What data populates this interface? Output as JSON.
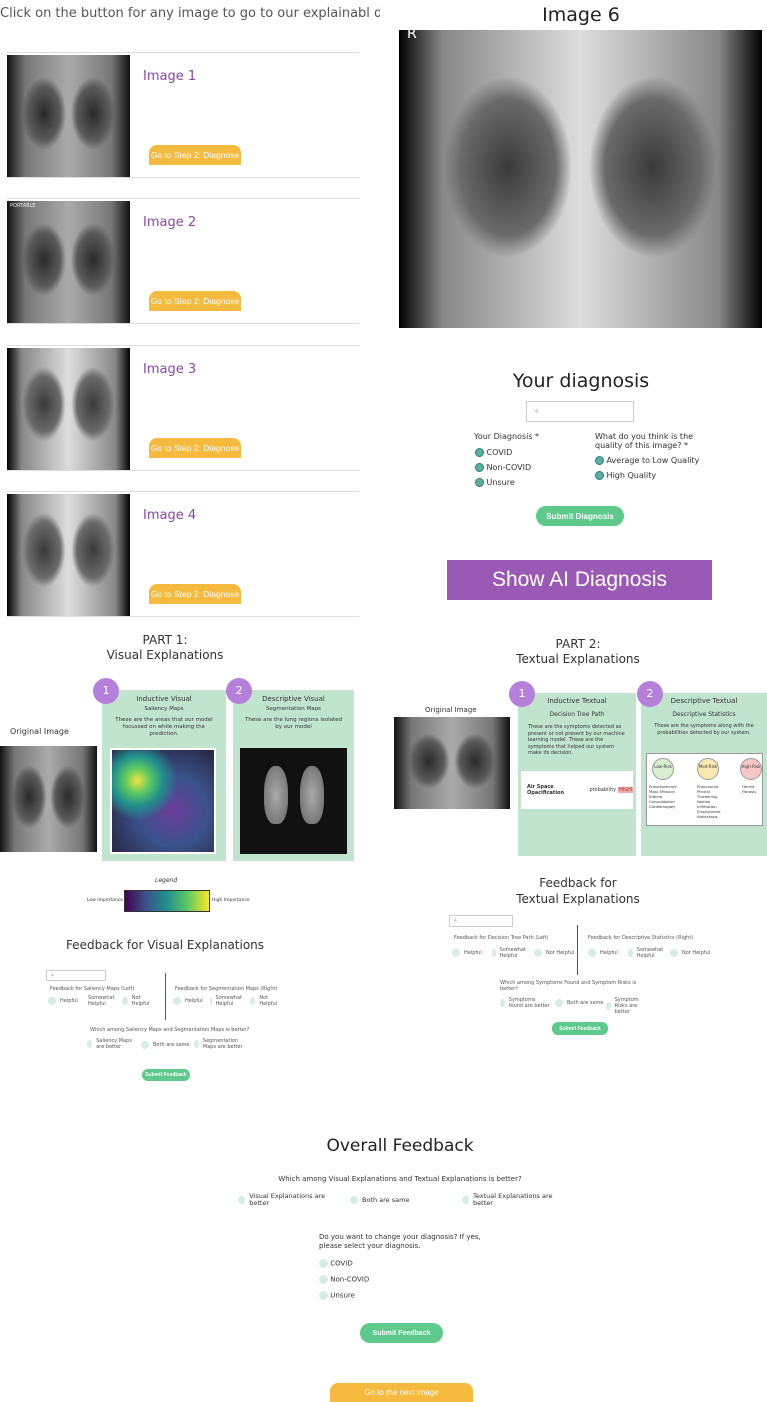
{
  "intro": "Click on the button for any image to go to our explainabl diagnoses",
  "images": [
    {
      "title": "Image 1",
      "button": "Go to Step 2: Diagnose"
    },
    {
      "title": "Image 2",
      "button": "Go to Step 2: Diagnose",
      "overlay": "PORTABLE"
    },
    {
      "title": "Image 3",
      "button": "Go to Step 2: Diagnose"
    },
    {
      "title": "Image 4",
      "button": "Go to Step 2: Diagnose"
    }
  ],
  "image6": {
    "title": "Image 6",
    "marker": "R"
  },
  "diagnosis": {
    "title": "Your diagnosis",
    "input_value": "4",
    "label": "Your Diagnosis *",
    "options": [
      "COVID",
      "Non-COVID",
      "Unsure"
    ],
    "quality_label": "What do you think is the quality of this image? *",
    "quality_options": [
      "Average to Low Quality",
      "High Quality"
    ],
    "submit": "Submit Diagnosis"
  },
  "show_ai": "Show AI Diagnosis",
  "part1": {
    "title": "PART 1:",
    "subtitle": "Visual Explanations",
    "original_label": "Original Image",
    "panel1": {
      "num": "1",
      "title": "Inductive Visual",
      "sub": "Saliency Maps",
      "desc": "These are the areas that our model focussed on while making the prediction."
    },
    "panel2": {
      "num": "2",
      "title": "Descriptive Visual",
      "sub": "Segmentation Maps",
      "desc": "These are the lung regions isolated by our model"
    },
    "legend": {
      "title": "Legend",
      "low": "Low Importance",
      "high": "High Importance"
    },
    "colors": {
      "panel": "#c1e4cf",
      "badge": "#b580d9"
    }
  },
  "part2": {
    "title": "PART 2:",
    "subtitle": "Textual Explanations",
    "original_label": "Original Image",
    "panel1": {
      "num": "1",
      "title": "Inductive Textual",
      "sub": "Decision Tree Path",
      "desc": "These are the symptoms detected as present or not present by our machine learning model. These are the symptoms that helped our system make its decision.",
      "finding": "Air Space Opacification",
      "prob_label": "probability",
      "prob_value": "HIGH"
    },
    "panel2": {
      "num": "2",
      "title": "Descriptive Textual",
      "sub": "Descriptive Statistics",
      "desc": "These are the symptoms along with the probabilities detected by our system.",
      "risks": [
        {
          "label": "Low-Risk",
          "items": "Pneumothorax Mass Effusion Edema Consolidation Cardiomegaly",
          "color": "#d8efd0"
        },
        {
          "label": "Med-Risk",
          "items": "Pneumonia Pleural Thickening Nodule Infiltration Emphysema Atelectasis",
          "color": "#fbe8b0"
        },
        {
          "label": "High-Risk",
          "items": "Hernia Fibrosis",
          "color": "#f7c6c6"
        }
      ]
    }
  },
  "feedback_visual": {
    "title": "Feedback for Visual Explanations",
    "input_value": "4",
    "left_label": "Feedback for Saliency Maps (Left)",
    "right_label": "Feedback for Segmentation Maps (Right)",
    "scale": [
      "Helpful",
      "Somewhat Helpful",
      "Not Helpful"
    ],
    "compare_q": "Which among Saliency Maps and Segmentation Maps is better?",
    "compare_opts": [
      "Saliency Maps are better",
      "Both are same",
      "Segmentation Maps are better"
    ],
    "submit": "Submit Feedback"
  },
  "feedback_textual": {
    "title": "Feedback for",
    "title2": "Textual Explanations",
    "input_value": "4",
    "left_label": "Feedback for Decision Tree Path (Left)",
    "right_label": "Feedback for Descriptive Statistics (Right)",
    "scale": [
      "Helpful",
      "Somewhat Helpful",
      "Not Helpful"
    ],
    "compare_q": "Which among Symptoms Found and Symptom Risks is better?",
    "compare_opts": [
      "Symptoms found are better",
      "Both are same",
      "Symptom Risks are better"
    ],
    "submit": "Submit Feedback"
  },
  "overall": {
    "title": "Overall Feedback",
    "q1": "Which among Visual Explanations and Textual Explanations is better?",
    "q1_opts": [
      "Visual Explanations are better",
      "Both are same",
      "Textual Explanations are better"
    ],
    "q2": "Do you want to change your diagnosis? If yes, please select your diagnosis.",
    "q2_opts": [
      "COVID",
      "Non-COVID",
      "Unsure"
    ],
    "submit": "Submit Feedback",
    "next": "Go to the next image"
  }
}
